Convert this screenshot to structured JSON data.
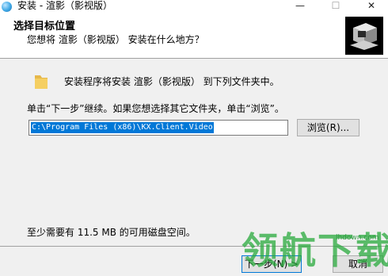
{
  "window": {
    "title": "安装 - 渲影（影视版）",
    "icon": "setup-app-icon",
    "controls": {
      "minimize": "—",
      "maximize": "☐",
      "close": "✕"
    }
  },
  "header": {
    "title": "选择目标位置",
    "subtitle": "您想将 渲影（影视版） 安装在什么地方？",
    "logo_icon": "installer-computer-icon"
  },
  "body": {
    "folder_icon": "folder-icon",
    "line1": "安装程序将安装 渲影（影视版） 到下列文件夹中。",
    "line2": "单击“下一步”继续。如果您想选择其它文件夹，单击“浏览”。",
    "path_value": "C:\\Program Files (x86)\\KX.Client.Video",
    "browse_label": "浏览(R)...",
    "space_required": "至少需要有 11.5 MB 的可用磁盘空间。"
  },
  "footer": {
    "next_label": "下一步(N) >",
    "cancel_label": "取消"
  },
  "watermark": {
    "brand": "领航下载",
    "url": "lhdown.com"
  },
  "colors": {
    "selection": "#0078d7",
    "watermark": "#28aa3c",
    "dialog_bg": "#f0f0f0"
  }
}
